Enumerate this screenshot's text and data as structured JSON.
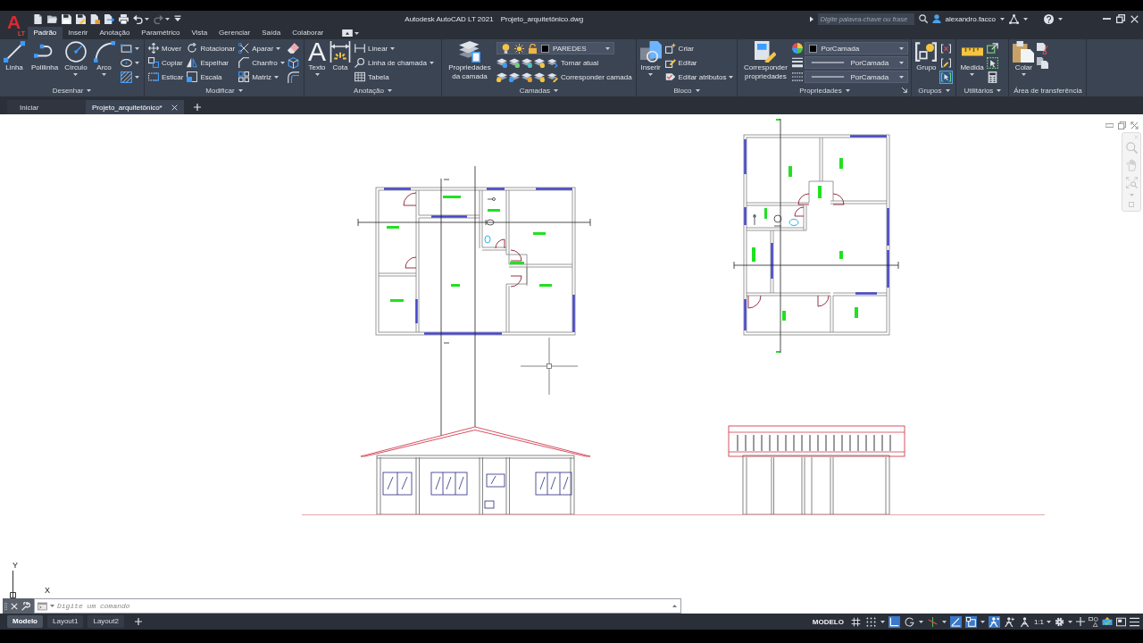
{
  "title_bar": {
    "logo": {
      "mark": "A",
      "edition": "LT"
    },
    "app_title": "Autodesk AutoCAD LT 2021",
    "document_title": "Projeto_arquitetônico.dwg",
    "search": {
      "placeholder": "Digite palavra-chave ou frase"
    },
    "user": "alexandro.facco"
  },
  "ribbon_tabs": [
    {
      "label": "Padrão",
      "selected": true
    },
    {
      "label": "Inserir",
      "selected": false
    },
    {
      "label": "Anotação",
      "selected": false
    },
    {
      "label": "Paramétrico",
      "selected": false
    },
    {
      "label": "Vista",
      "selected": false
    },
    {
      "label": "Gerenciar",
      "selected": false
    },
    {
      "label": "Saída",
      "selected": false
    },
    {
      "label": "Colaborar",
      "selected": false
    }
  ],
  "ribbon_panels": [
    {
      "title": "Desenhar",
      "menu": true,
      "columns": [
        {
          "kind": "large",
          "label": "Linha",
          "dropdown": false
        },
        {
          "kind": "large",
          "label": "Polilinha",
          "dropdown": false
        },
        {
          "kind": "large",
          "label": "Círculo",
          "dropdown": true
        },
        {
          "kind": "large",
          "label": "Arco",
          "dropdown": true
        },
        {
          "kind": "icons"
        }
      ]
    },
    {
      "title": "Modificar",
      "menu": true,
      "columns": [
        {
          "kind": "stack",
          "items": [
            {
              "kind": "button",
              "label": "Mover",
              "dropdown": false
            },
            {
              "kind": "button",
              "label": "Copiar",
              "dropdown": false
            },
            {
              "kind": "button",
              "label": "Esticar",
              "dropdown": false
            }
          ]
        },
        {
          "kind": "stack",
          "items": [
            {
              "kind": "button",
              "label": "Rotacionar",
              "dropdown": false
            },
            {
              "kind": "button",
              "label": "Espelhar",
              "dropdown": false
            },
            {
              "kind": "button",
              "label": "Escala",
              "dropdown": false
            }
          ]
        },
        {
          "kind": "stack",
          "items": [
            {
              "kind": "button",
              "label": "Aparar",
              "dropdown": true
            },
            {
              "kind": "button",
              "label": "Chanfro",
              "dropdown": true
            },
            {
              "kind": "button",
              "label": "Matriz",
              "dropdown": true
            }
          ]
        },
        {
          "kind": "icons"
        }
      ]
    },
    {
      "title": "Anotação",
      "menu": true,
      "columns": [
        {
          "kind": "large",
          "label": "Texto",
          "glyph": "A",
          "dropdown": true
        },
        {
          "kind": "large",
          "label": "Cota",
          "dropdown": false
        },
        {
          "kind": "stack",
          "items": [
            {
              "kind": "button",
              "label": "Linear",
              "dropdown": true
            },
            {
              "kind": "button",
              "label": "Linha de chamada",
              "dropdown": true
            },
            {
              "kind": "button",
              "label": "Tabela",
              "dropdown": false
            }
          ]
        }
      ]
    },
    {
      "title": "Camadas",
      "menu": true,
      "columns": [
        {
          "kind": "large",
          "label": "Propriedades da camada",
          "dropdown": false
        },
        {
          "kind": "stack",
          "items": [
            {
              "kind": "combo",
              "value": "PAREDES"
            },
            {
              "kind": "button",
              "label": "Tornar atual",
              "dropdown": false
            },
            {
              "kind": "button",
              "label": "Corresponder camada",
              "dropdown": false
            }
          ]
        }
      ]
    },
    {
      "title": "Bloco",
      "menu": true,
      "columns": [
        {
          "kind": "large",
          "label": "Inserir",
          "dropdown": true
        },
        {
          "kind": "stack",
          "items": [
            {
              "kind": "button",
              "label": "Criar",
              "dropdown": false
            },
            {
              "kind": "button",
              "label": "Editar",
              "dropdown": false
            },
            {
              "kind": "button",
              "label": "Editar atributos",
              "dropdown": true
            }
          ]
        }
      ]
    },
    {
      "title": "Propriedades",
      "menu": true,
      "launcher": true,
      "columns": [
        {
          "kind": "large",
          "label": "Corresponder propriedades",
          "dropdown": false
        },
        {
          "kind": "stack",
          "items": [
            {
              "kind": "combo",
              "value": "PorCamada"
            },
            {
              "kind": "combo",
              "value": "PorCamada"
            },
            {
              "kind": "combo",
              "value": "PorCamada"
            }
          ]
        }
      ]
    },
    {
      "title": "Grupos",
      "menu": true,
      "columns": [
        {
          "kind": "large",
          "label": "Grupo",
          "dropdown": false
        },
        {
          "kind": "icons",
          "items": [
            {
              "on": false
            },
            {
              "on": false
            },
            {
              "on": true
            }
          ]
        }
      ]
    },
    {
      "title": "Utilitários",
      "menu": true,
      "columns": [
        {
          "kind": "large",
          "label": "Medida",
          "dropdown": true
        },
        {
          "kind": "icons"
        }
      ]
    },
    {
      "title": "Área de transferência",
      "menu": false,
      "columns": [
        {
          "kind": "large",
          "label": "Colar",
          "dropdown": true
        },
        {
          "kind": "icons"
        }
      ]
    }
  ],
  "document_tabs": [
    {
      "label": "Iniciar",
      "selected": false,
      "closable": false
    },
    {
      "label": "Projeto_arquitetônico*",
      "selected": true,
      "closable": true
    }
  ],
  "ucs": {
    "y_axis": "Y",
    "x_axis": "X"
  },
  "command_line": {
    "placeholder": "Digite um comando"
  },
  "layout_tabs": [
    {
      "label": "Modelo",
      "selected": true
    },
    {
      "label": "Layout1",
      "selected": false
    },
    {
      "label": "Layout2",
      "selected": false
    }
  ],
  "status_bar": {
    "space": "MODELO",
    "annotation_scale": "1:1",
    "toggles": [
      {
        "on": false
      },
      {
        "on": false
      },
      {
        "on": true
      },
      {
        "on": false
      },
      {
        "on": false
      },
      {
        "on": true
      },
      {
        "on": true
      },
      {
        "on": true
      },
      {
        "on": false
      },
      {
        "on": false
      }
    ]
  }
}
